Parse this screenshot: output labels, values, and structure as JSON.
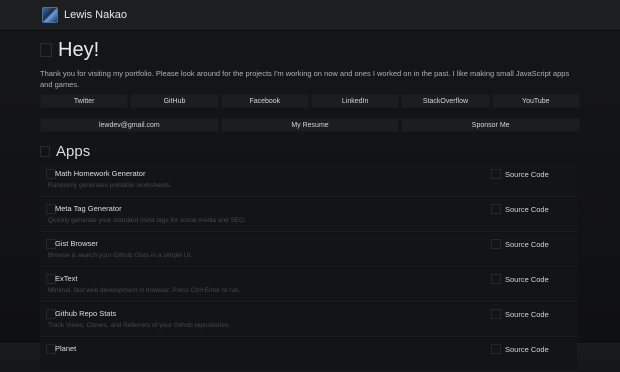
{
  "header": {
    "name": "Lewis Nakao"
  },
  "intro": {
    "title": "Hey!",
    "text": "Thank you for visiting my portfolio. Please look around for the projects I'm working on now and ones I worked on in the past. I like making small JavaScript apps and games."
  },
  "social": [
    "Twitter",
    "GitHub",
    "Facebook",
    "LinkedIn",
    "StackOverflow",
    "YouTube"
  ],
  "links": [
    "lewdev@gmail.com",
    "My Resume",
    "Sponsor Me"
  ],
  "apps_section": {
    "title": "Apps",
    "source_label": "Source Code",
    "items": [
      {
        "name": "Math Homework Generator",
        "desc": "Randomly generates printable worksheets."
      },
      {
        "name": "Meta Tag Generator",
        "desc": "Quickly generate your standard meta tags for social media and SEO."
      },
      {
        "name": "Gist Browser",
        "desc": "Browse & search your Github Gists in a simple UI."
      },
      {
        "name": "ExText",
        "desc": "Minimal, fast web development in browser. Press Ctrl+Enter to run."
      },
      {
        "name": "Github Repo Stats",
        "desc": "Track Views, Clones, and Referrers of your Github repositories."
      },
      {
        "name": "Planet",
        "desc": ""
      }
    ]
  }
}
